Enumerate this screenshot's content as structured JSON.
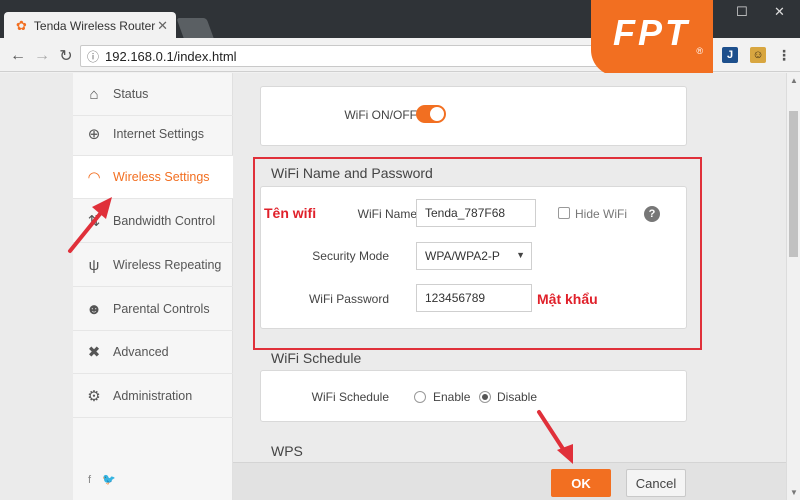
{
  "browser": {
    "tab_title": "Tenda Wireless Router",
    "tab_close": "✕",
    "url": "192.168.0.1/index.html",
    "window_controls": [
      "—",
      "☐",
      "✕"
    ]
  },
  "brand": {
    "logo_text": "FPT",
    "logo_color": "#f26f21"
  },
  "sidebar": {
    "items": [
      {
        "label": "Status",
        "icon": "router-status-icon",
        "glyph": "⌂"
      },
      {
        "label": "Internet Settings",
        "icon": "globe-icon",
        "glyph": "⊕"
      },
      {
        "label": "Wireless Settings",
        "icon": "wifi-icon",
        "glyph": "◠"
      },
      {
        "label": "Bandwidth Control",
        "icon": "bandwidth-icon",
        "glyph": "⇅"
      },
      {
        "label": "Wireless Repeating",
        "icon": "repeater-icon",
        "glyph": "ψ"
      },
      {
        "label": "Parental Controls",
        "icon": "parental-icon",
        "glyph": "☻"
      },
      {
        "label": "Advanced",
        "icon": "tools-icon",
        "glyph": "✖"
      },
      {
        "label": "Administration",
        "icon": "gear-icon",
        "glyph": "⚙"
      }
    ],
    "active": "Wireless Settings",
    "social": "f  🐦"
  },
  "wifi_toggle": {
    "label": "WiFi ON/OFF",
    "on": true
  },
  "name_password": {
    "title": "WiFi Name and Password",
    "wifi_name_label": "WiFi Name",
    "wifi_name_value": "Tenda_787F68",
    "hide_wifi_label": "Hide WiFi",
    "help_glyph": "?",
    "security_mode_label": "Security Mode",
    "security_mode_value": "WPA/WPA2-P",
    "password_label": "WiFi Password",
    "password_value": "123456789"
  },
  "annotations": {
    "wifi_name_note": "Tên wifi",
    "password_note": "Mật khẩu",
    "highlight_color": "#e0303a"
  },
  "schedule": {
    "title": "WiFi Schedule",
    "label": "WiFi Schedule",
    "enable_label": "Enable",
    "disable_label": "Disable",
    "selected": "Disable"
  },
  "wps": {
    "title": "WPS"
  },
  "buttons": {
    "ok": "OK",
    "cancel": "Cancel"
  }
}
